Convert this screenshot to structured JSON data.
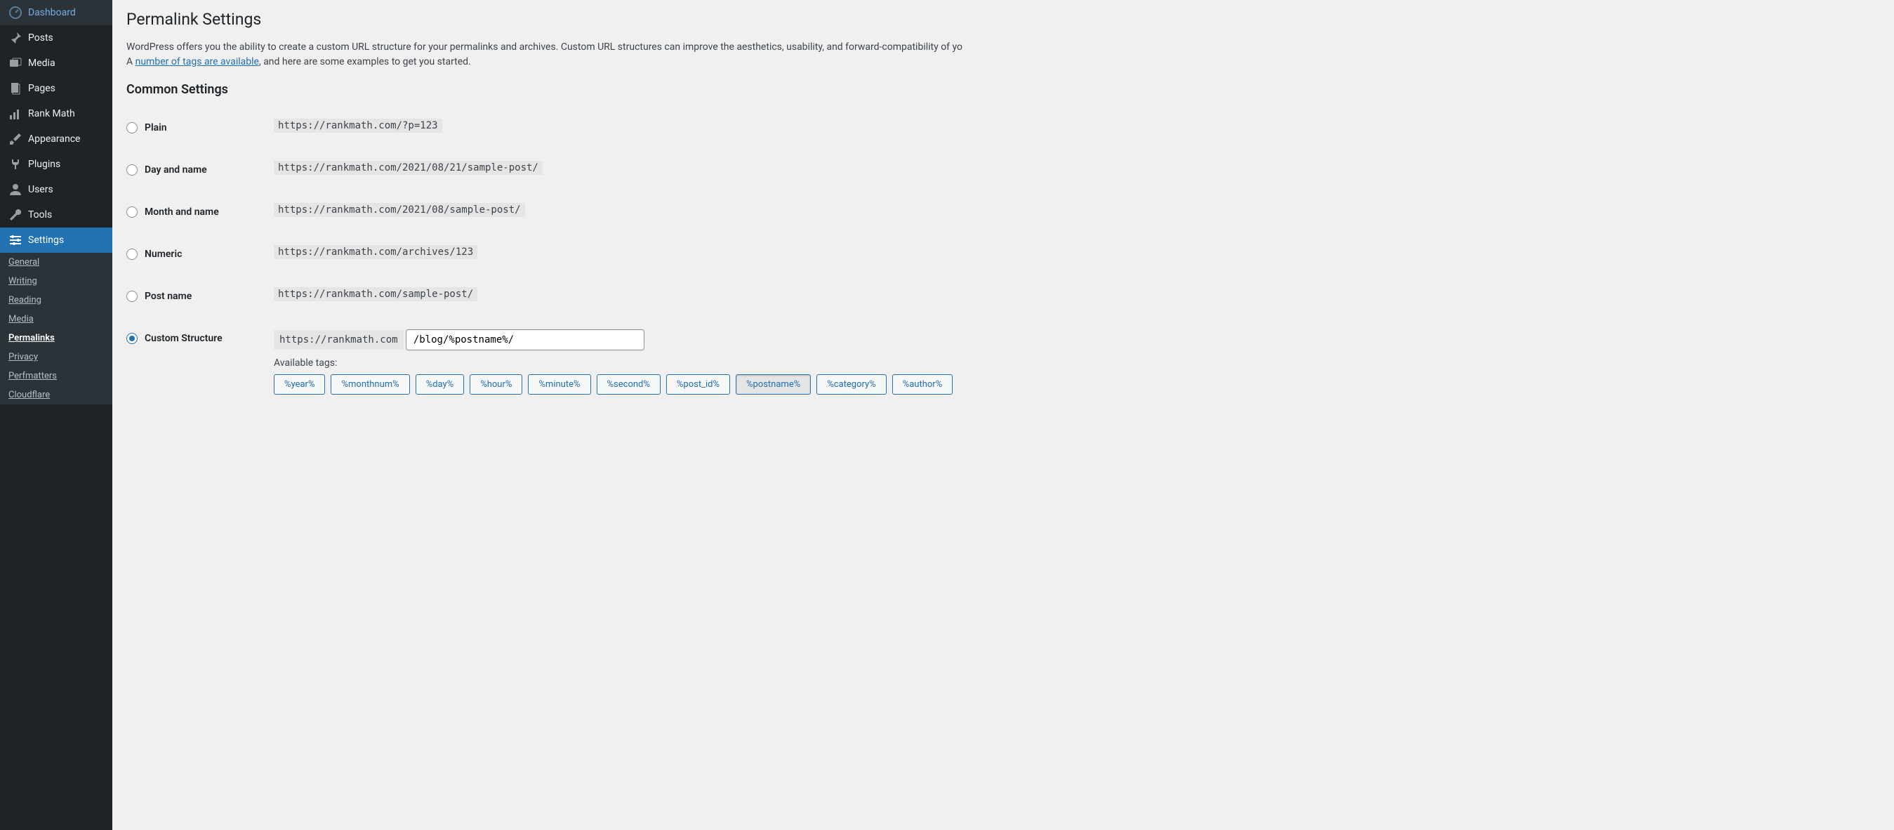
{
  "sidebar": {
    "items": [
      {
        "label": "Dashboard"
      },
      {
        "label": "Posts"
      },
      {
        "label": "Media"
      },
      {
        "label": "Pages"
      },
      {
        "label": "Rank Math"
      },
      {
        "label": "Appearance"
      },
      {
        "label": "Plugins"
      },
      {
        "label": "Users"
      },
      {
        "label": "Tools"
      },
      {
        "label": "Settings"
      }
    ],
    "subitems": [
      {
        "label": "General"
      },
      {
        "label": "Writing"
      },
      {
        "label": "Reading"
      },
      {
        "label": "Media"
      },
      {
        "label": "Permalinks"
      },
      {
        "label": "Privacy"
      },
      {
        "label": "Perfmatters"
      },
      {
        "label": "Cloudflare"
      }
    ]
  },
  "page": {
    "title": "Permalink Settings",
    "desc_pre": "WordPress offers you the ability to create a custom URL structure for your permalinks and archives. Custom URL structures can improve the aesthetics, usability, and forward-compatibility of yo",
    "desc_a_pre": "A ",
    "desc_link": "number of tags are available",
    "desc_after": ", and here are some examples to get you started.",
    "section": "Common Settings"
  },
  "options": {
    "plain": {
      "label": "Plain",
      "code": "https://rankmath.com/?p=123"
    },
    "day": {
      "label": "Day and name",
      "code": "https://rankmath.com/2021/08/21/sample-post/"
    },
    "month": {
      "label": "Month and name",
      "code": "https://rankmath.com/2021/08/sample-post/"
    },
    "numeric": {
      "label": "Numeric",
      "code": "https://rankmath.com/archives/123"
    },
    "postname": {
      "label": "Post name",
      "code": "https://rankmath.com/sample-post/"
    },
    "custom": {
      "label": "Custom Structure",
      "prefix": "https://rankmath.com",
      "value": "/blog/%postname%/"
    }
  },
  "tags": {
    "title": "Available tags:",
    "items": [
      "%year%",
      "%monthnum%",
      "%day%",
      "%hour%",
      "%minute%",
      "%second%",
      "%post_id%",
      "%postname%",
      "%category%",
      "%author%"
    ]
  }
}
